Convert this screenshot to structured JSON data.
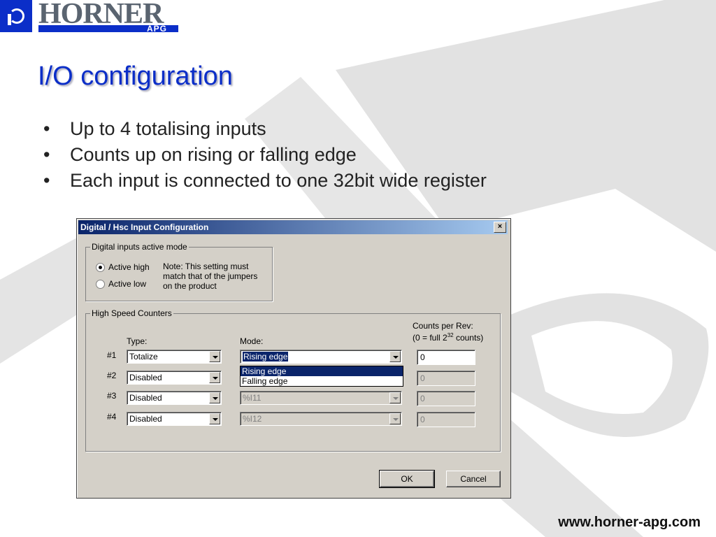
{
  "logo": {
    "brand": "HORNER",
    "sub": "APG"
  },
  "slide": {
    "title": "I/O configuration",
    "bullets": [
      "Up to 4 totalising inputs",
      "Counts up on rising or falling edge",
      "Each input is connected to one 32bit wide register"
    ],
    "bullet_glyph": "•",
    "footer_url": "www.horner-apg.com"
  },
  "dialog": {
    "title": "Digital / Hsc Input Configuration",
    "close_glyph": "×",
    "active_mode": {
      "legend": "Digital inputs active mode",
      "options": [
        "Active high",
        "Active low"
      ],
      "selected": "Active high",
      "note": "Note: This setting must match that of the jumpers on the product"
    },
    "hsc": {
      "legend": "High Speed Counters",
      "type_label": "Type:",
      "mode_label": "Mode:",
      "counts_label_line1": "Counts per Rev:",
      "counts_label_line2_pre": "(0 = full 2",
      "counts_label_sup": "32",
      "counts_label_line2_post": " counts)",
      "rows": [
        {
          "label": "#1",
          "type": "Totalize",
          "mode": "Rising edge",
          "counts": "0"
        },
        {
          "label": "#2",
          "type": "Disabled",
          "mode": "",
          "counts": "0"
        },
        {
          "label": "#3",
          "type": "Disabled",
          "mode": "%I11",
          "counts": "0"
        },
        {
          "label": "#4",
          "type": "Disabled",
          "mode": "%I12",
          "counts": "0"
        }
      ],
      "mode_options": [
        "Rising edge",
        "Falling edge"
      ]
    },
    "ok_label": "OK",
    "cancel_label": "Cancel"
  },
  "colors": {
    "brand_blue": "#0b2ec8",
    "titlebar": "#0a246a",
    "dialog_bg": "#d4d0c8"
  }
}
